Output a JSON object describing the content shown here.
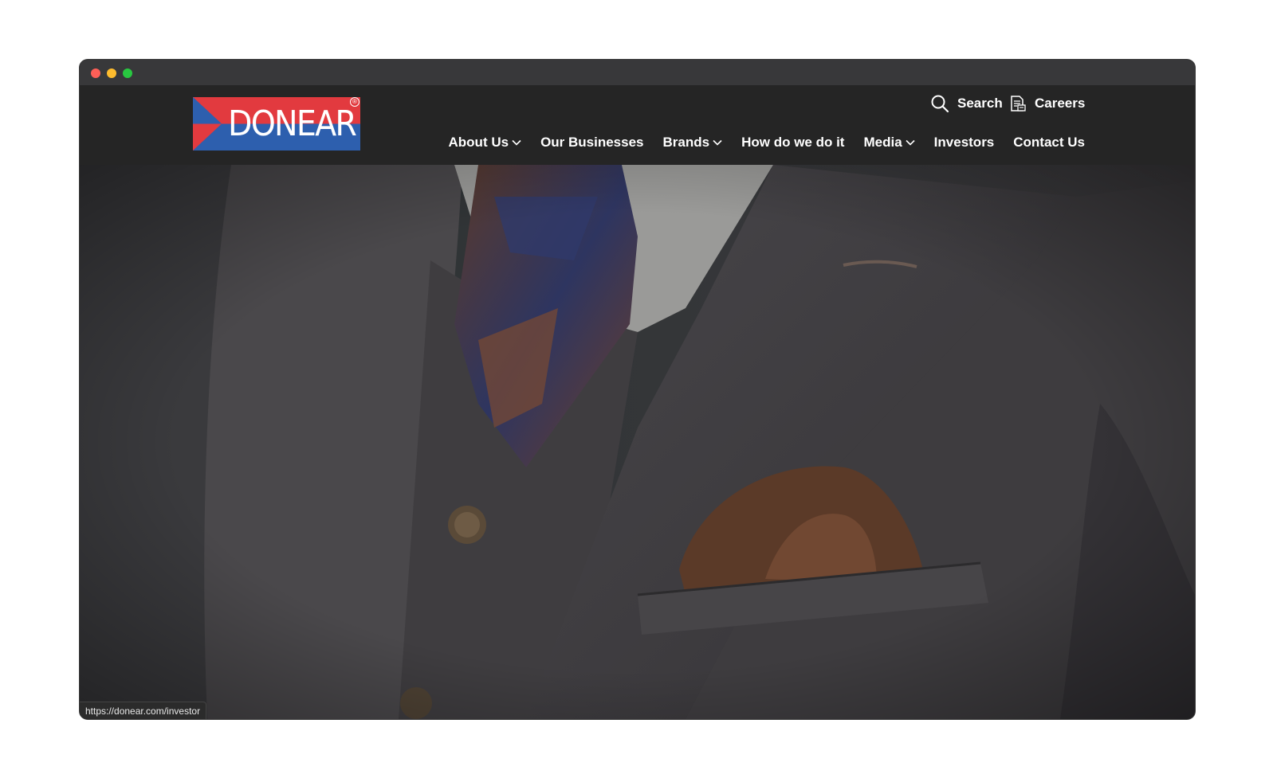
{
  "window": {
    "controls": [
      "close",
      "minimize",
      "zoom"
    ]
  },
  "header": {
    "logo": {
      "text": "DONEAR",
      "registered": "®",
      "colors": {
        "red": "#e23a3f",
        "blue": "#2d5fae"
      }
    },
    "utility": {
      "search_label": "Search",
      "search_icon": "search-icon",
      "careers_label": "Careers",
      "careers_icon": "document-icon"
    },
    "nav": {
      "items": [
        {
          "label": "About Us",
          "dropdown": true
        },
        {
          "label": "Our Businesses",
          "dropdown": false
        },
        {
          "label": "Brands",
          "dropdown": true
        },
        {
          "label": "How do we do it",
          "dropdown": false
        },
        {
          "label": "Media",
          "dropdown": true
        },
        {
          "label": "Investors",
          "dropdown": false
        },
        {
          "label": "Contact Us",
          "dropdown": false
        }
      ]
    }
  },
  "status_bar": {
    "url": "https://donear.com/investor"
  },
  "colors": {
    "header_bg": "#252525",
    "titlebar_bg": "#38383a",
    "text": "#ffffff"
  }
}
